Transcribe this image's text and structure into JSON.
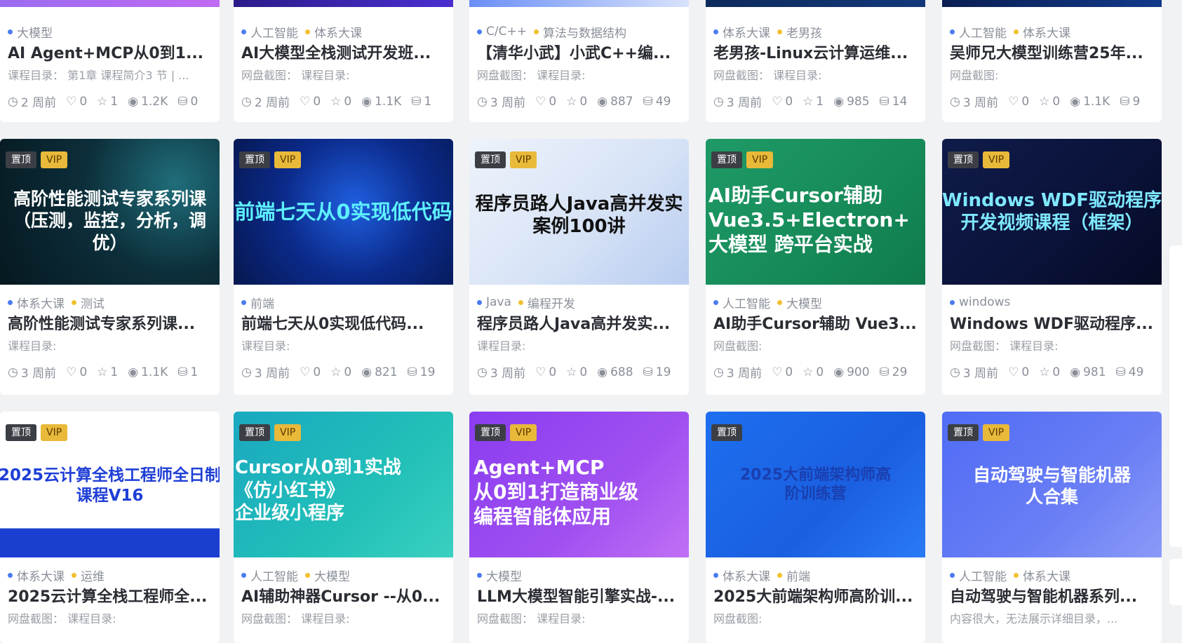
{
  "rows": [
    {
      "cards": [
        {
          "tags": [
            "大模型"
          ],
          "title": "AI Agent+MCP从0到1...",
          "excerpt": "课程目录：  第1章 课程简介3 节 | ...",
          "stats": {
            "time": "2 周前",
            "likes": "0",
            "favs": "1",
            "views": "1.2K",
            "coins": "0"
          }
        },
        {
          "tags": [
            "人工智能",
            "体系大课"
          ],
          "title": "AI大模型全栈测试开发班...",
          "excerpt": "网盘截图：   课程目录:",
          "stats": {
            "time": "2 周前",
            "likes": "0",
            "favs": "0",
            "views": "1.1K",
            "coins": "1"
          }
        },
        {
          "tags": [
            "C/C++",
            "算法与数据结构"
          ],
          "title": "【清华小武】小武C++编...",
          "excerpt": "网盘截图：   课程目录:",
          "stats": {
            "time": "3 周前",
            "likes": "0",
            "favs": "0",
            "views": "887",
            "coins": "49"
          }
        },
        {
          "tags": [
            "体系大课",
            "老男孩"
          ],
          "title": "老男孩-Linux云计算运维...",
          "excerpt": "网盘截图：   课程目录:",
          "stats": {
            "time": "3 周前",
            "likes": "0",
            "favs": "1",
            "views": "985",
            "coins": "14"
          }
        },
        {
          "tags": [
            "人工智能",
            "体系大课"
          ],
          "title": "吴师兄大模型训练营25年...",
          "excerpt": "网盘截图:",
          "stats": {
            "time": "3 周前",
            "likes": "0",
            "favs": "0",
            "views": "1.1K",
            "coins": "9"
          }
        }
      ]
    },
    {
      "cards": [
        {
          "badges": [
            "置顶",
            "VIP"
          ],
          "banner": "高阶性能测试专家系列课\n（压测，监控，分析，调\n优）",
          "tags": [
            "体系大课",
            "测试"
          ],
          "title": "高阶性能测试专家系列课...",
          "excerpt": "课程目录:",
          "stats": {
            "time": "3 周前",
            "likes": "0",
            "favs": "1",
            "views": "1.1K",
            "coins": "1"
          }
        },
        {
          "badges": [
            "置顶",
            "VIP"
          ],
          "banner": "前端七天从0实现低代码",
          "tags": [
            "前端"
          ],
          "title": "前端七天从0实现低代码...",
          "excerpt": "课程目录:",
          "stats": {
            "time": "3 周前",
            "likes": "0",
            "favs": "0",
            "views": "821",
            "coins": "19"
          }
        },
        {
          "badges": [
            "置顶",
            "VIP"
          ],
          "banner": "程序员路人Java高并发实\n案例100讲",
          "tags": [
            "Java",
            "编程开发"
          ],
          "title": "程序员路人Java高并发实...",
          "excerpt": "课程目录:",
          "stats": {
            "time": "3 周前",
            "likes": "0",
            "favs": "0",
            "views": "688",
            "coins": "19"
          }
        },
        {
          "badges": [
            "置顶",
            "VIP"
          ],
          "banner": "AI助手Cursor辅助\nVue3.5+Electron+\n大模型 跨平台实战",
          "tags": [
            "人工智能",
            "大模型"
          ],
          "title": "AI助手Cursor辅助 Vue3....",
          "excerpt": "网盘截图:",
          "stats": {
            "time": "3 周前",
            "likes": "0",
            "favs": "0",
            "views": "900",
            "coins": "29"
          }
        },
        {
          "badges": [
            "置顶",
            "VIP"
          ],
          "banner": "Windows WDF驱动程序\n开发视频课程（框架）",
          "tags": [
            "windows"
          ],
          "title": "Windows WDF驱动程序...",
          "excerpt": "网盘截图：   课程目录:",
          "stats": {
            "time": "3 周前",
            "likes": "0",
            "favs": "0",
            "views": "981",
            "coins": "49"
          }
        }
      ]
    },
    {
      "cards": [
        {
          "badges": [
            "置顶",
            "VIP"
          ],
          "banner": "2025云计算全栈工程师全日制\n课程V16",
          "tags": [
            "体系大课",
            "运维"
          ],
          "title": "2025云计算全栈工程师全...",
          "excerpt": "网盘截图：   课程目录:"
        },
        {
          "badges": [
            "置顶",
            "VIP"
          ],
          "banner": "Cursor从0到1实战\n《仿小红书》\n企业级小程序",
          "tags": [
            "人工智能",
            "大模型"
          ],
          "title": "AI辅助神器Cursor --从0...",
          "excerpt": "网盘截图：   课程目录:"
        },
        {
          "badges": [
            "置顶",
            "VIP"
          ],
          "banner": "Agent+MCP\n从0到1打造商业级\n编程智能体应用",
          "tags": [
            "大模型"
          ],
          "title": "LLM大模型智能引擎实战-...",
          "excerpt": "网盘截图：   课程目录:"
        },
        {
          "badges": [
            "置顶"
          ],
          "banner": "2025大前端架构师高\n阶训练营",
          "tags": [
            "体系大课",
            "前端"
          ],
          "title": "2025大前端架构师高阶训...",
          "excerpt": "网盘截图:"
        },
        {
          "badges": [
            "置顶",
            "VIP"
          ],
          "banner": "自动驾驶与智能机器\n人合集",
          "tags": [
            "人工智能",
            "体系大课"
          ],
          "title": "自动驾驶与智能机器系列...",
          "excerpt": "内容很大，无法展示详细目录，..."
        }
      ]
    }
  ],
  "colors": {
    "accent_blue": "#4a7bf0",
    "accent_yellow": "#f2c030",
    "top_badge": "#3b3f45",
    "vip_badge": "#e9b93a"
  }
}
